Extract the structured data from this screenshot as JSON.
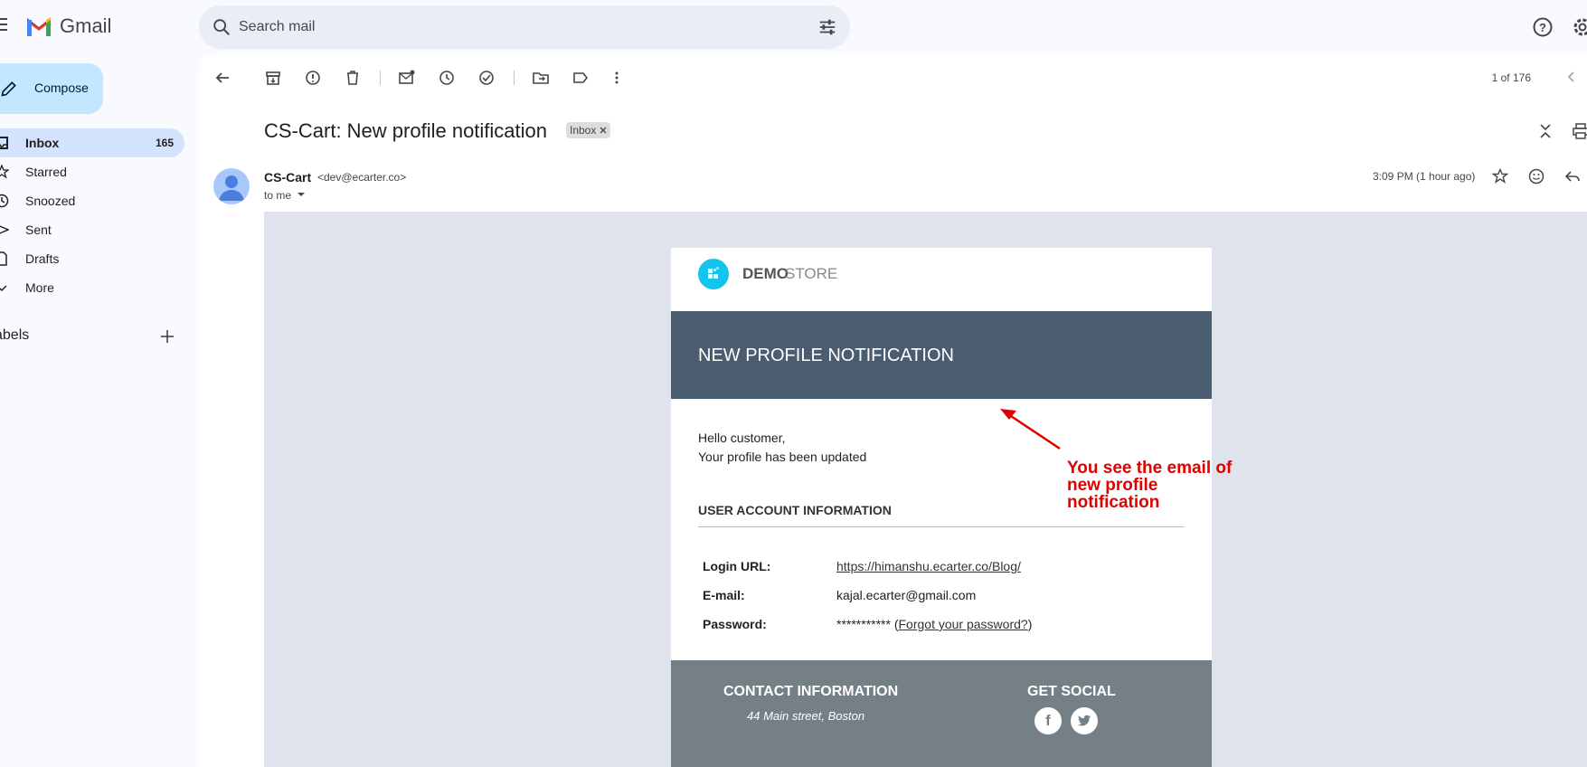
{
  "app": {
    "name": "Gmail"
  },
  "search": {
    "placeholder": "Search mail"
  },
  "sidebar": {
    "compose_label": "Compose",
    "items": [
      {
        "label": "Inbox",
        "count": "165",
        "icon": "inbox-icon"
      },
      {
        "label": "Starred",
        "count": "",
        "icon": "star-icon"
      },
      {
        "label": "Snoozed",
        "count": "",
        "icon": "clock-icon"
      },
      {
        "label": "Sent",
        "count": "",
        "icon": "send-icon"
      },
      {
        "label": "Drafts",
        "count": "",
        "icon": "draft-icon"
      },
      {
        "label": "More",
        "count": "",
        "icon": "chevron-down-icon"
      }
    ],
    "labels_header": "abels"
  },
  "toolbar": {
    "pager": "1 of 176"
  },
  "message": {
    "subject": "CS-Cart: New profile notification",
    "label_chip": "Inbox",
    "sender_name": "CS-Cart",
    "sender_email": "<dev@ecarter.co>",
    "to": "to me",
    "time": "3:09 PM (1 hour ago)"
  },
  "email": {
    "store_name_bold": "DEMO",
    "store_name_light": "STORE",
    "banner_title": "NEW PROFILE NOTIFICATION",
    "greeting_line1": "Hello customer,",
    "greeting_line2": "Your profile has been updated",
    "section_title": "USER ACCOUNT INFORMATION",
    "rows": [
      {
        "label": "Login URL:",
        "value": "https://himanshu.ecarter.co/Blog/"
      },
      {
        "label": "E-mail:",
        "value": "kajal.ecarter@gmail.com"
      },
      {
        "label": "Password:",
        "value": "***********",
        "extra": "Forgot your password?"
      }
    ],
    "footer_contact_title": "CONTACT INFORMATION",
    "footer_address": "44 Main street, Boston",
    "footer_social_title": "GET SOCIAL"
  },
  "annotation": {
    "text": "You see the email of new profile notification",
    "color": "#e00000"
  },
  "colors": {
    "accent": "#c2e7ff",
    "active_nav": "#d3e3fd",
    "banner": "#4a5d70",
    "footer": "#757f86",
    "store_logo": "#13c4ee"
  }
}
